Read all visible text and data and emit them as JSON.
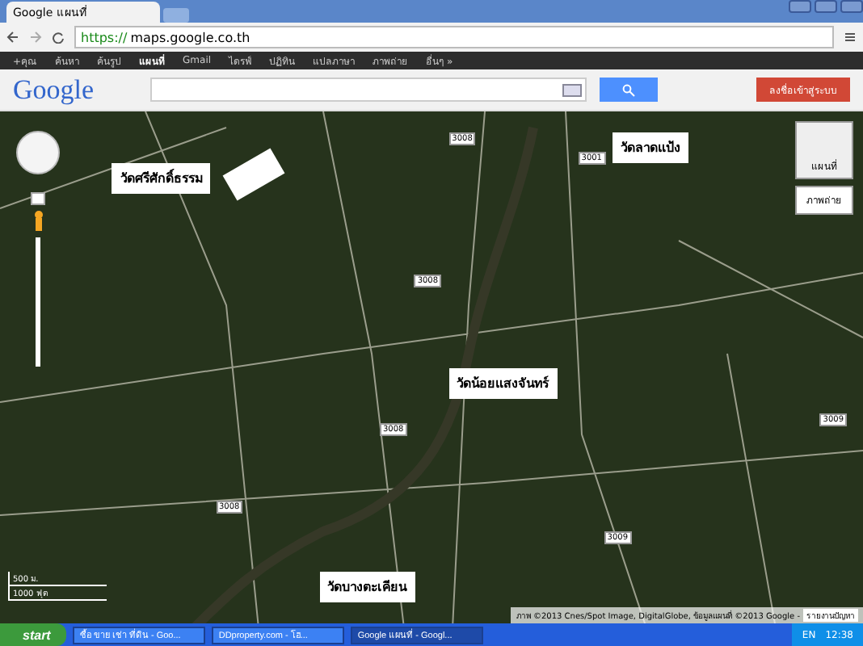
{
  "browser": {
    "tab_title": "Google แผนที่",
    "url_scheme": "https://",
    "url_rest": "maps.google.co.th"
  },
  "nav": [
    {
      "label": "+คุณ",
      "selected": false
    },
    {
      "label": "ค้นหา",
      "selected": false
    },
    {
      "label": "ค้นรูป",
      "selected": false
    },
    {
      "label": "แผนที่",
      "selected": true
    },
    {
      "label": "Gmail",
      "selected": false
    },
    {
      "label": "ไดรฟ์",
      "selected": false
    },
    {
      "label": "ปฏิทิน",
      "selected": false
    },
    {
      "label": "แปลภาษา",
      "selected": false
    },
    {
      "label": "ภาพถ่าย",
      "selected": false
    },
    {
      "label": "อื่นๆ »",
      "selected": false
    }
  ],
  "header": {
    "logo": "Google",
    "sign_in": "ลงชื่อเข้าสู่ระบบ"
  },
  "map": {
    "places": [
      "วัดศรีศักดิ์ธรรม",
      "วัดลาดแป้ง",
      "วัดน้อยแสงจันทร์",
      "วัดบางตะเคียน"
    ],
    "roads": [
      "3008",
      "3001",
      "3008",
      "3008",
      "3008",
      "3009",
      "3009"
    ],
    "map_types": [
      {
        "label": "แผนที่",
        "kind": "thumb"
      },
      {
        "label": "ภาพถ่าย",
        "kind": "dropdown"
      }
    ],
    "scale": [
      "500 ม.",
      "1000 ฟุต"
    ],
    "attribution": "ภาพ ©2013 Cnes/Spot Image, DigitalGlobe, ข้อมูลแผนที่ ©2013 Google -",
    "report": "รายงานปัญหา"
  },
  "taskbar": {
    "start": "start",
    "windows": [
      {
        "label": "ซื้อ ขาย เช่า ที่ดิน - Goo...",
        "selected": false
      },
      {
        "label": "DDproperty.com - โฮ...",
        "selected": false
      },
      {
        "label": "Google แผนที่ - Googl...",
        "selected": true
      }
    ],
    "lang": "EN",
    "time": "12:38"
  }
}
